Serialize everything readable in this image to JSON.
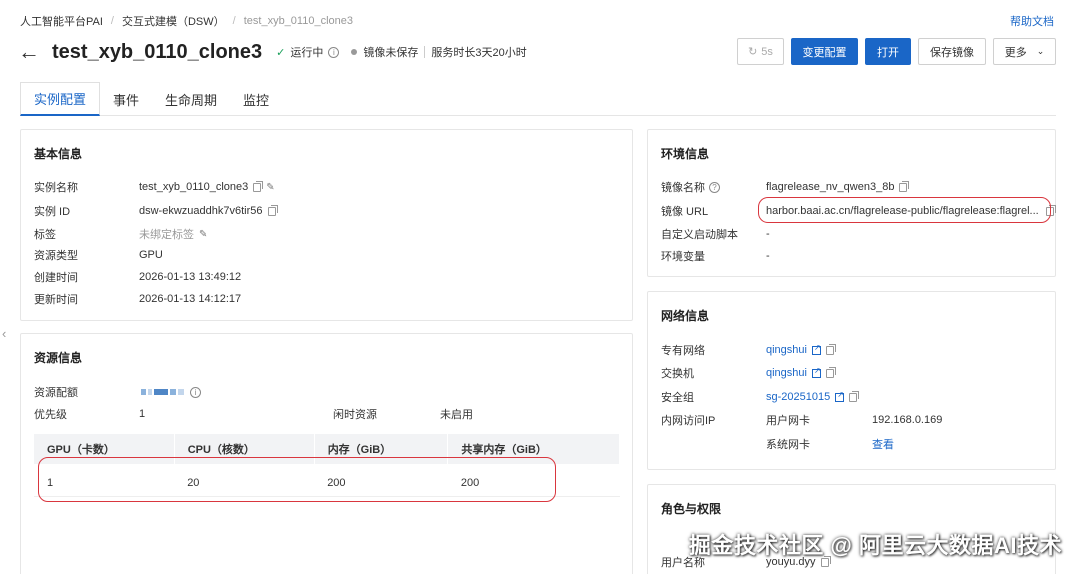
{
  "breadcrumb": [
    "人工智能平台PAI",
    "交互式建模（DSW）",
    "test_xyb_0110_clone3"
  ],
  "help_link": "帮助文档",
  "header": {
    "title": "test_xyb_0110_clone3",
    "status": "运行中",
    "image_status": "镜像未保存",
    "duration": "服务时长3天20小时"
  },
  "actions": {
    "refresh": "5s",
    "change_config": "变更配置",
    "open": "打开",
    "save_image": "保存镜像",
    "more": "更多"
  },
  "tabs": [
    "实例配置",
    "事件",
    "生命周期",
    "监控"
  ],
  "basic_info": {
    "title": "基本信息",
    "rows": [
      {
        "label": "实例名称",
        "value": "test_xyb_0110_clone3"
      },
      {
        "label": "实例 ID",
        "value": "dsw-ekwzuaddhk7v6tir56"
      },
      {
        "label": "标签",
        "value": "未绑定标签"
      },
      {
        "label": "资源类型",
        "value": "GPU"
      },
      {
        "label": "创建时间",
        "value": "2026-01-13 13:49:12"
      },
      {
        "label": "更新时间",
        "value": "2026-01-13 14:12:17"
      }
    ]
  },
  "resource_info": {
    "title": "资源信息",
    "quota_label": "资源配额",
    "priority_label": "优先级",
    "priority_value": "1",
    "idle_label": "闲时资源",
    "idle_value": "未启用",
    "headers": [
      "GPU（卡数）",
      "CPU（核数）",
      "内存（GiB）",
      "共享内存（GiB）"
    ],
    "row": [
      "1",
      "20",
      "200",
      "200"
    ]
  },
  "env_info": {
    "title": "环境信息",
    "rows": [
      {
        "label": "镜像名称",
        "value": "flagrelease_nv_qwen3_8b"
      },
      {
        "label": "镜像 URL",
        "value": "harbor.baai.ac.cn/flagrelease-public/flagrelease:flagrel..."
      },
      {
        "label": "自定义启动脚本",
        "value": "-"
      },
      {
        "label": "环境变量",
        "value": "-"
      }
    ]
  },
  "network_info": {
    "title": "网络信息",
    "rows": [
      {
        "label": "专有网络",
        "value": "qingshui"
      },
      {
        "label": "交换机",
        "value": "qingshui"
      },
      {
        "label": "安全组",
        "value": "sg-20251015"
      },
      {
        "label": "内网访问IP",
        "value": ""
      }
    ],
    "user_nic_label": "用户网卡",
    "user_nic_value": "192.168.0.169",
    "system_nic_label": "系统网卡",
    "system_nic_value": "查看"
  },
  "role_info": {
    "title": "角色与权限",
    "user_label": "用户名称",
    "user_value": "youyu.dyy"
  },
  "watermark": "掘金技术社区 @ 阿里云大数据AI技术",
  "colors": {
    "primary": "#1a66c7",
    "highlight": "#d9363e",
    "success": "#1aa05a"
  }
}
